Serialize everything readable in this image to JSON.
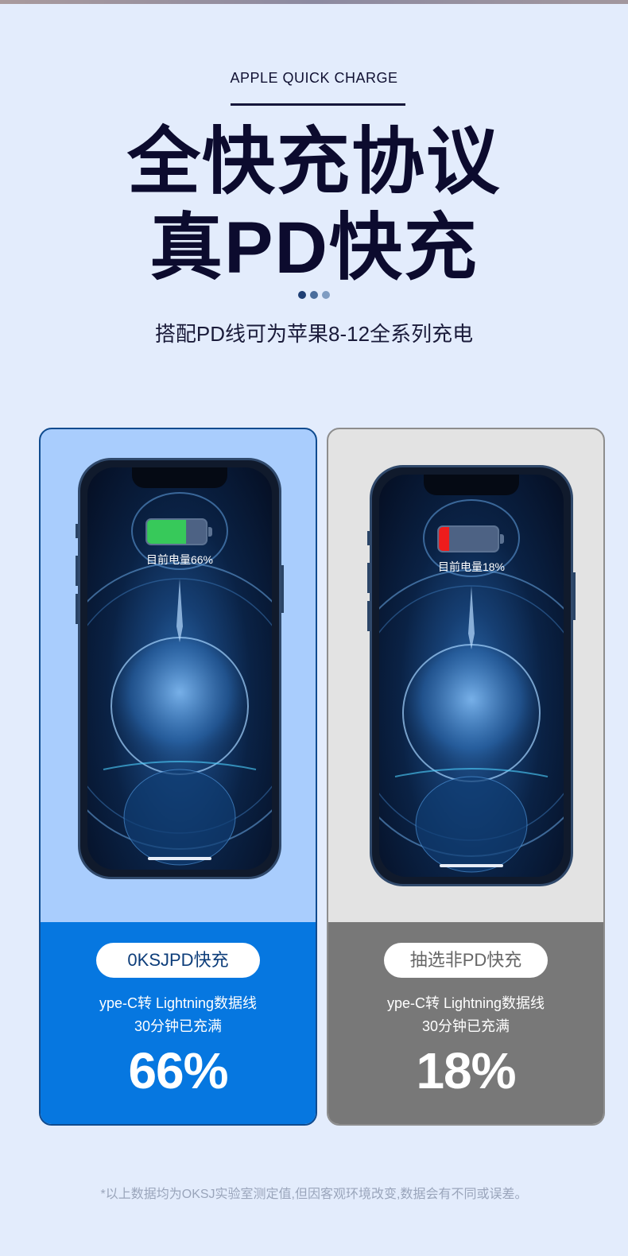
{
  "header": {
    "eyebrow": "APPLE QUICK CHARGE",
    "headline_line1": "全快充协议",
    "headline_line2": "真PD快充",
    "subtitle": "搭配PD线可为苹果8-12全系列充电"
  },
  "colors": {
    "dot1": "#1f3f74",
    "dot2": "#4a6d9c",
    "dot3": "#7f9cc2",
    "battery_green": "#37c95a",
    "battery_red": "#ee1c1c"
  },
  "cards": [
    {
      "phone_battery_label": "目前电量66%",
      "battery_level": 0.66,
      "battery_color": "#37c95a",
      "pill": "0KSJPD快充",
      "desc_line1": "ype-C转 Lightning数据线",
      "desc_line2": "30分钟已充满",
      "percent": "66%"
    },
    {
      "phone_battery_label": "目前电量18%",
      "battery_level": 0.18,
      "battery_color": "#ee1c1c",
      "pill": "抽选非PD快充",
      "desc_line1": "ype-C转 Lightning数据线",
      "desc_line2": "30分钟已充满",
      "percent": "18%"
    }
  ],
  "footnote": "*以上数据均为OKSJ实验室测定值,但因客观环境改变,数据会有不同或误差。"
}
